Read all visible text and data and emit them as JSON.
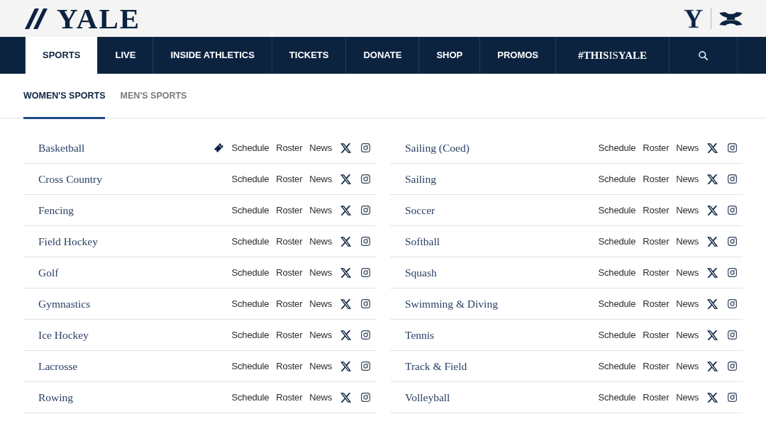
{
  "header": {
    "logo_text": "YALE",
    "mark": "Y"
  },
  "nav": {
    "items": [
      {
        "kind": "label",
        "label": "SPORTS",
        "selected": true
      },
      {
        "kind": "label",
        "label": "LIVE",
        "selected": false
      },
      {
        "kind": "label",
        "label": "INSIDE ATHLETICS",
        "selected": false
      },
      {
        "kind": "label",
        "label": "TICKETS",
        "selected": false
      },
      {
        "kind": "label",
        "label": "DONATE",
        "selected": false
      },
      {
        "kind": "label",
        "label": "SHOP",
        "selected": false
      },
      {
        "kind": "label",
        "label": "PROMOS",
        "selected": false
      },
      {
        "kind": "wordmark",
        "label": "**#THIS**IS**YALE**",
        "selected": false
      }
    ]
  },
  "sport_tabs": [
    {
      "label": "WOMEN'S SPORTS",
      "selected": true
    },
    {
      "label": "MEN'S SPORTS",
      "selected": false
    }
  ],
  "sport_columns": [
    {
      "sports": [
        {
          "name": "Basketball",
          "tickets": true,
          "links": [
            "Schedule",
            "Roster",
            "News"
          ]
        },
        {
          "name": "Cross Country",
          "tickets": false,
          "links": [
            "Schedule",
            "Roster",
            "News"
          ]
        },
        {
          "name": "Fencing",
          "tickets": false,
          "links": [
            "Schedule",
            "Roster",
            "News"
          ]
        },
        {
          "name": "Field Hockey",
          "tickets": false,
          "links": [
            "Schedule",
            "Roster",
            "News"
          ]
        },
        {
          "name": "Golf",
          "tickets": false,
          "links": [
            "Schedule",
            "Roster",
            "News"
          ]
        },
        {
          "name": "Gymnastics",
          "tickets": false,
          "links": [
            "Schedule",
            "Roster",
            "News"
          ]
        },
        {
          "name": "Ice Hockey",
          "tickets": false,
          "links": [
            "Schedule",
            "Roster",
            "News"
          ]
        },
        {
          "name": "Lacrosse",
          "tickets": false,
          "links": [
            "Schedule",
            "Roster",
            "News"
          ]
        },
        {
          "name": "Rowing",
          "tickets": false,
          "links": [
            "Schedule",
            "Roster",
            "News"
          ]
        }
      ]
    },
    {
      "sports": [
        {
          "name": "Sailing (Coed)",
          "tickets": false,
          "links": [
            "Schedule",
            "Roster",
            "News"
          ]
        },
        {
          "name": "Sailing",
          "tickets": false,
          "links": [
            "Schedule",
            "Roster",
            "News"
          ]
        },
        {
          "name": "Soccer",
          "tickets": false,
          "links": [
            "Schedule",
            "Roster",
            "News"
          ]
        },
        {
          "name": "Softball",
          "tickets": false,
          "links": [
            "Schedule",
            "Roster",
            "News"
          ]
        },
        {
          "name": "Squash",
          "tickets": false,
          "links": [
            "Schedule",
            "Roster",
            "News"
          ]
        },
        {
          "name": "Swimming & Diving",
          "tickets": false,
          "links": [
            "Schedule",
            "Roster",
            "News"
          ]
        },
        {
          "name": "Tennis",
          "tickets": false,
          "links": [
            "Schedule",
            "Roster",
            "News"
          ]
        },
        {
          "name": "Track & Field",
          "tickets": false,
          "links": [
            "Schedule",
            "Roster",
            "News"
          ]
        },
        {
          "name": "Volleyball",
          "tickets": false,
          "links": [
            "Schedule",
            "Roster",
            "News"
          ]
        }
      ]
    }
  ]
}
